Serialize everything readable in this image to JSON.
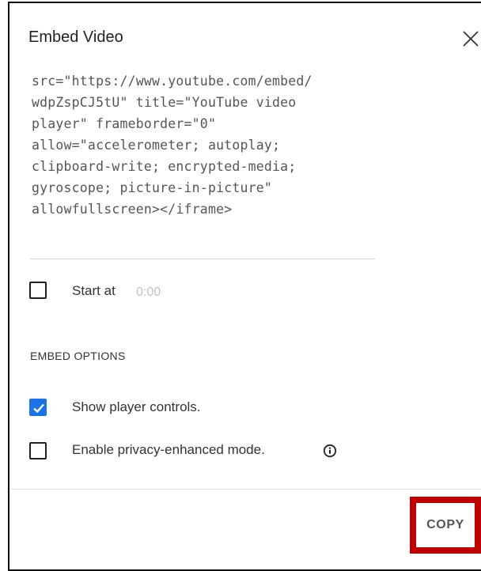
{
  "dialog": {
    "title": "Embed Video"
  },
  "embed_code": {
    "lines": [
      "src=\"https://www.youtube.com/embed/",
      "wdpZspCJ5tU\" title=\"YouTube video",
      "player\" frameborder=\"0\"",
      "allow=\"accelerometer; autoplay;",
      "clipboard-write; encrypted-media;",
      "gyroscope; picture-in-picture\"",
      "allowfullscreen></iframe>"
    ]
  },
  "start_at": {
    "label": "Start at",
    "time": "0:00",
    "checked": false
  },
  "embed_options": {
    "heading": "EMBED OPTIONS",
    "show_controls": {
      "label": "Show player controls.",
      "checked": true
    },
    "privacy_mode": {
      "label": "Enable privacy-enhanced mode.",
      "checked": false
    }
  },
  "actions": {
    "copy_label": "COPY"
  },
  "colors": {
    "checkbox_checked": "#1a73e8",
    "highlight": "#c00000"
  },
  "icons": {
    "close": "close-icon",
    "check": "check-icon",
    "info": "info-icon"
  }
}
